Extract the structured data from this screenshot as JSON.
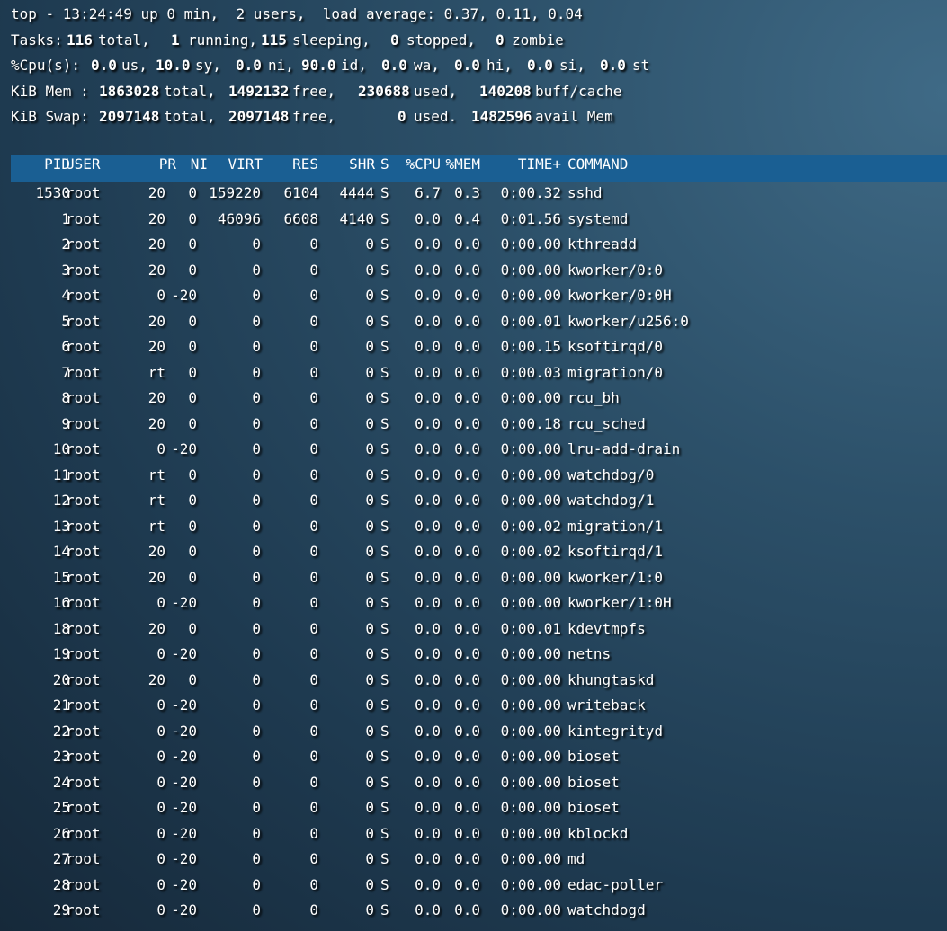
{
  "summary": {
    "line1": "top - 13:24:49 up 0 min,  2 users,  load average: 0.37, 0.11, 0.04",
    "tasks": {
      "label": "Tasks:",
      "total": "116",
      "total_label": "total,",
      "running": "1",
      "running_label": "running,",
      "sleeping": "115",
      "sleeping_label": "sleeping,",
      "stopped": "0",
      "stopped_label": "stopped,",
      "zombie": "0",
      "zombie_label": "zombie"
    },
    "cpu": {
      "label": "%Cpu(s):",
      "us": "0.0",
      "us_label": "us,",
      "sy": "10.0",
      "sy_label": "sy,",
      "ni": "0.0",
      "ni_label": "ni,",
      "id": "90.0",
      "id_label": "id,",
      "wa": "0.0",
      "wa_label": "wa,",
      "hi": "0.0",
      "hi_label": "hi,",
      "si": "0.0",
      "si_label": "si,",
      "st": "0.0",
      "st_label": "st"
    },
    "mem": {
      "label": "KiB Mem :",
      "total": "1863028",
      "total_label": "total,",
      "free": "1492132",
      "free_label": "free,",
      "used": "230688",
      "used_label": "used,",
      "cache": "140208",
      "cache_label": "buff/cache"
    },
    "swap": {
      "label": "KiB Swap:",
      "total": "2097148",
      "total_label": "total,",
      "free": "2097148",
      "free_label": "free,",
      "used": "0",
      "used_label": "used.",
      "avail": "1482596",
      "avail_label": "avail Mem"
    }
  },
  "columns": [
    "PID",
    "USER",
    "PR",
    "NI",
    "VIRT",
    "RES",
    "SHR",
    "S",
    "%CPU",
    "%MEM",
    "TIME+",
    "COMMAND"
  ],
  "processes": [
    [
      "1530",
      "root",
      "20",
      "0",
      "159220",
      "6104",
      "4444",
      "S",
      "6.7",
      "0.3",
      "0:00.32",
      "sshd"
    ],
    [
      "1",
      "root",
      "20",
      "0",
      "46096",
      "6608",
      "4140",
      "S",
      "0.0",
      "0.4",
      "0:01.56",
      "systemd"
    ],
    [
      "2",
      "root",
      "20",
      "0",
      "0",
      "0",
      "0",
      "S",
      "0.0",
      "0.0",
      "0:00.00",
      "kthreadd"
    ],
    [
      "3",
      "root",
      "20",
      "0",
      "0",
      "0",
      "0",
      "S",
      "0.0",
      "0.0",
      "0:00.00",
      "kworker/0:0"
    ],
    [
      "4",
      "root",
      "0",
      "-20",
      "0",
      "0",
      "0",
      "S",
      "0.0",
      "0.0",
      "0:00.00",
      "kworker/0:0H"
    ],
    [
      "5",
      "root",
      "20",
      "0",
      "0",
      "0",
      "0",
      "S",
      "0.0",
      "0.0",
      "0:00.01",
      "kworker/u256:0"
    ],
    [
      "6",
      "root",
      "20",
      "0",
      "0",
      "0",
      "0",
      "S",
      "0.0",
      "0.0",
      "0:00.15",
      "ksoftirqd/0"
    ],
    [
      "7",
      "root",
      "rt",
      "0",
      "0",
      "0",
      "0",
      "S",
      "0.0",
      "0.0",
      "0:00.03",
      "migration/0"
    ],
    [
      "8",
      "root",
      "20",
      "0",
      "0",
      "0",
      "0",
      "S",
      "0.0",
      "0.0",
      "0:00.00",
      "rcu_bh"
    ],
    [
      "9",
      "root",
      "20",
      "0",
      "0",
      "0",
      "0",
      "S",
      "0.0",
      "0.0",
      "0:00.18",
      "rcu_sched"
    ],
    [
      "10",
      "root",
      "0",
      "-20",
      "0",
      "0",
      "0",
      "S",
      "0.0",
      "0.0",
      "0:00.00",
      "lru-add-drain"
    ],
    [
      "11",
      "root",
      "rt",
      "0",
      "0",
      "0",
      "0",
      "S",
      "0.0",
      "0.0",
      "0:00.00",
      "watchdog/0"
    ],
    [
      "12",
      "root",
      "rt",
      "0",
      "0",
      "0",
      "0",
      "S",
      "0.0",
      "0.0",
      "0:00.00",
      "watchdog/1"
    ],
    [
      "13",
      "root",
      "rt",
      "0",
      "0",
      "0",
      "0",
      "S",
      "0.0",
      "0.0",
      "0:00.02",
      "migration/1"
    ],
    [
      "14",
      "root",
      "20",
      "0",
      "0",
      "0",
      "0",
      "S",
      "0.0",
      "0.0",
      "0:00.02",
      "ksoftirqd/1"
    ],
    [
      "15",
      "root",
      "20",
      "0",
      "0",
      "0",
      "0",
      "S",
      "0.0",
      "0.0",
      "0:00.00",
      "kworker/1:0"
    ],
    [
      "16",
      "root",
      "0",
      "-20",
      "0",
      "0",
      "0",
      "S",
      "0.0",
      "0.0",
      "0:00.00",
      "kworker/1:0H"
    ],
    [
      "18",
      "root",
      "20",
      "0",
      "0",
      "0",
      "0",
      "S",
      "0.0",
      "0.0",
      "0:00.01",
      "kdevtmpfs"
    ],
    [
      "19",
      "root",
      "0",
      "-20",
      "0",
      "0",
      "0",
      "S",
      "0.0",
      "0.0",
      "0:00.00",
      "netns"
    ],
    [
      "20",
      "root",
      "20",
      "0",
      "0",
      "0",
      "0",
      "S",
      "0.0",
      "0.0",
      "0:00.00",
      "khungtaskd"
    ],
    [
      "21",
      "root",
      "0",
      "-20",
      "0",
      "0",
      "0",
      "S",
      "0.0",
      "0.0",
      "0:00.00",
      "writeback"
    ],
    [
      "22",
      "root",
      "0",
      "-20",
      "0",
      "0",
      "0",
      "S",
      "0.0",
      "0.0",
      "0:00.00",
      "kintegrityd"
    ],
    [
      "23",
      "root",
      "0",
      "-20",
      "0",
      "0",
      "0",
      "S",
      "0.0",
      "0.0",
      "0:00.00",
      "bioset"
    ],
    [
      "24",
      "root",
      "0",
      "-20",
      "0",
      "0",
      "0",
      "S",
      "0.0",
      "0.0",
      "0:00.00",
      "bioset"
    ],
    [
      "25",
      "root",
      "0",
      "-20",
      "0",
      "0",
      "0",
      "S",
      "0.0",
      "0.0",
      "0:00.00",
      "bioset"
    ],
    [
      "26",
      "root",
      "0",
      "-20",
      "0",
      "0",
      "0",
      "S",
      "0.0",
      "0.0",
      "0:00.00",
      "kblockd"
    ],
    [
      "27",
      "root",
      "0",
      "-20",
      "0",
      "0",
      "0",
      "S",
      "0.0",
      "0.0",
      "0:00.00",
      "md"
    ],
    [
      "28",
      "root",
      "0",
      "-20",
      "0",
      "0",
      "0",
      "S",
      "0.0",
      "0.0",
      "0:00.00",
      "edac-poller"
    ],
    [
      "29",
      "root",
      "0",
      "-20",
      "0",
      "0",
      "0",
      "S",
      "0.0",
      "0.0",
      "0:00.00",
      "watchdogd"
    ]
  ]
}
